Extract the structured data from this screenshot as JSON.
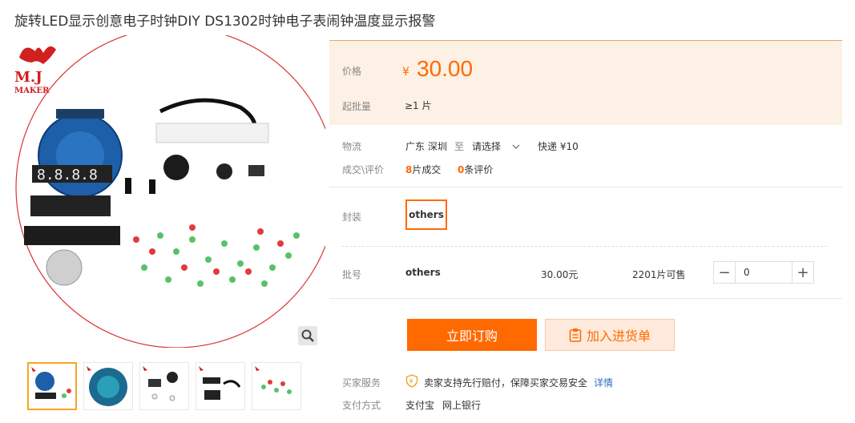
{
  "product": {
    "title": "旋转LED显示创意电子时钟DIY DS1302时钟电子表闹钟温度显示报警"
  },
  "gallery": {
    "brand_name": "M.J",
    "brand_sub": "MAKER",
    "thumb_count": 5,
    "active_thumb": 0
  },
  "price": {
    "label": "价格",
    "symbol": "¥",
    "value": "30.00",
    "min_label": "起批量",
    "min_value": "≥1 片"
  },
  "logistics": {
    "label": "物流",
    "from": "广东 深圳",
    "to_word": "至",
    "destination": "请选择",
    "shipping": "快递 ¥10"
  },
  "deals": {
    "label": "成交\\评价",
    "sold_count": "8",
    "sold_text": "片成交",
    "review_count": "0",
    "review_text": "条评价"
  },
  "package": {
    "label": "封装",
    "option": "others"
  },
  "batch": {
    "label": "批号",
    "value": "others",
    "price": "30.00元",
    "stock": "2201片可售",
    "minus": "−",
    "plus": "+",
    "quantity": "0"
  },
  "actions": {
    "buy_label": "立即订购",
    "cart_label": "加入进货单"
  },
  "service": {
    "label": "买家服务",
    "text": "卖家支持先行赔付，保障买家交易安全",
    "link": "详情"
  },
  "payment": {
    "label": "支付方式",
    "methods": [
      "支付宝",
      "网上银行"
    ]
  },
  "colors": {
    "accent": "#ff6a00",
    "price_bg": "#fdf0e4",
    "link": "#2f6ec2"
  }
}
